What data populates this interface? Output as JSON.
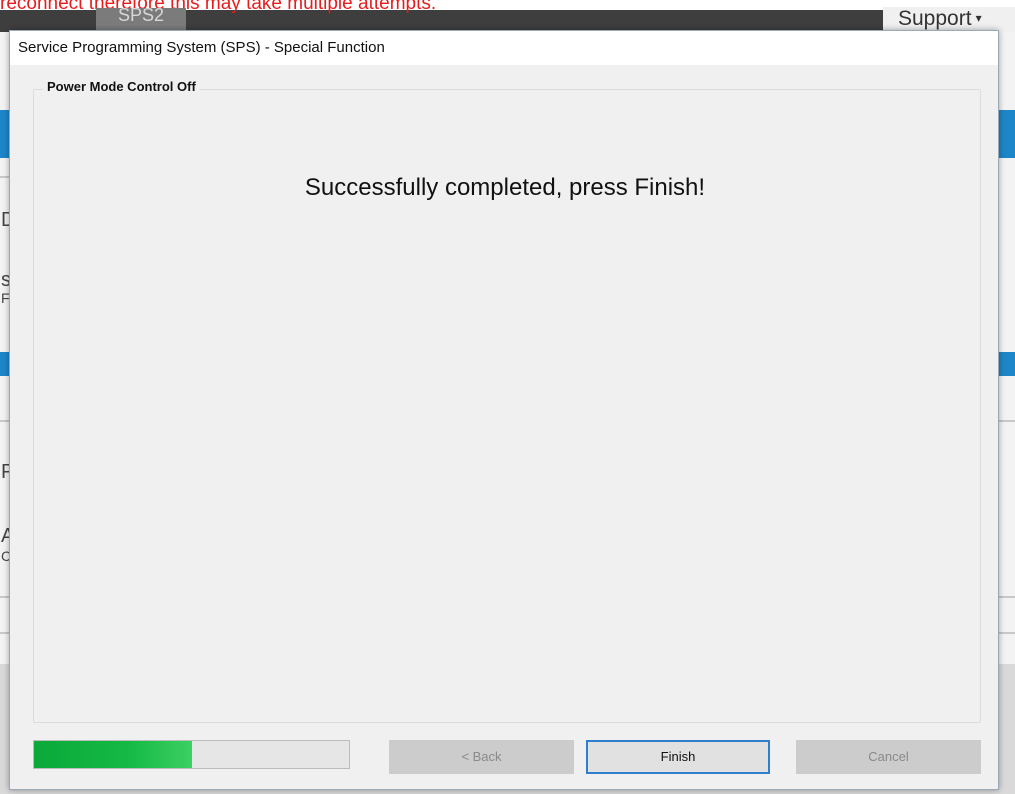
{
  "background": {
    "note_text": "reconnect therefore this may take multiple attempts.",
    "app_tab": "SPS2",
    "support_menu": "Support",
    "caret": "▾",
    "glyphs": [
      "D",
      "s",
      "F",
      "P",
      "A",
      "C"
    ]
  },
  "dialog": {
    "title": "Service Programming System (SPS) - Special Function",
    "group_label": "Power Mode Control Off",
    "message": "Successfully completed, press Finish!",
    "progress_percent": 50,
    "buttons": {
      "back": "< Back",
      "finish": "Finish",
      "cancel": "Cancel"
    }
  },
  "colors": {
    "accent": "#2f7fce",
    "progress": "#16b945",
    "note": "#e81c1c",
    "app_blue": "#1d86c8"
  }
}
